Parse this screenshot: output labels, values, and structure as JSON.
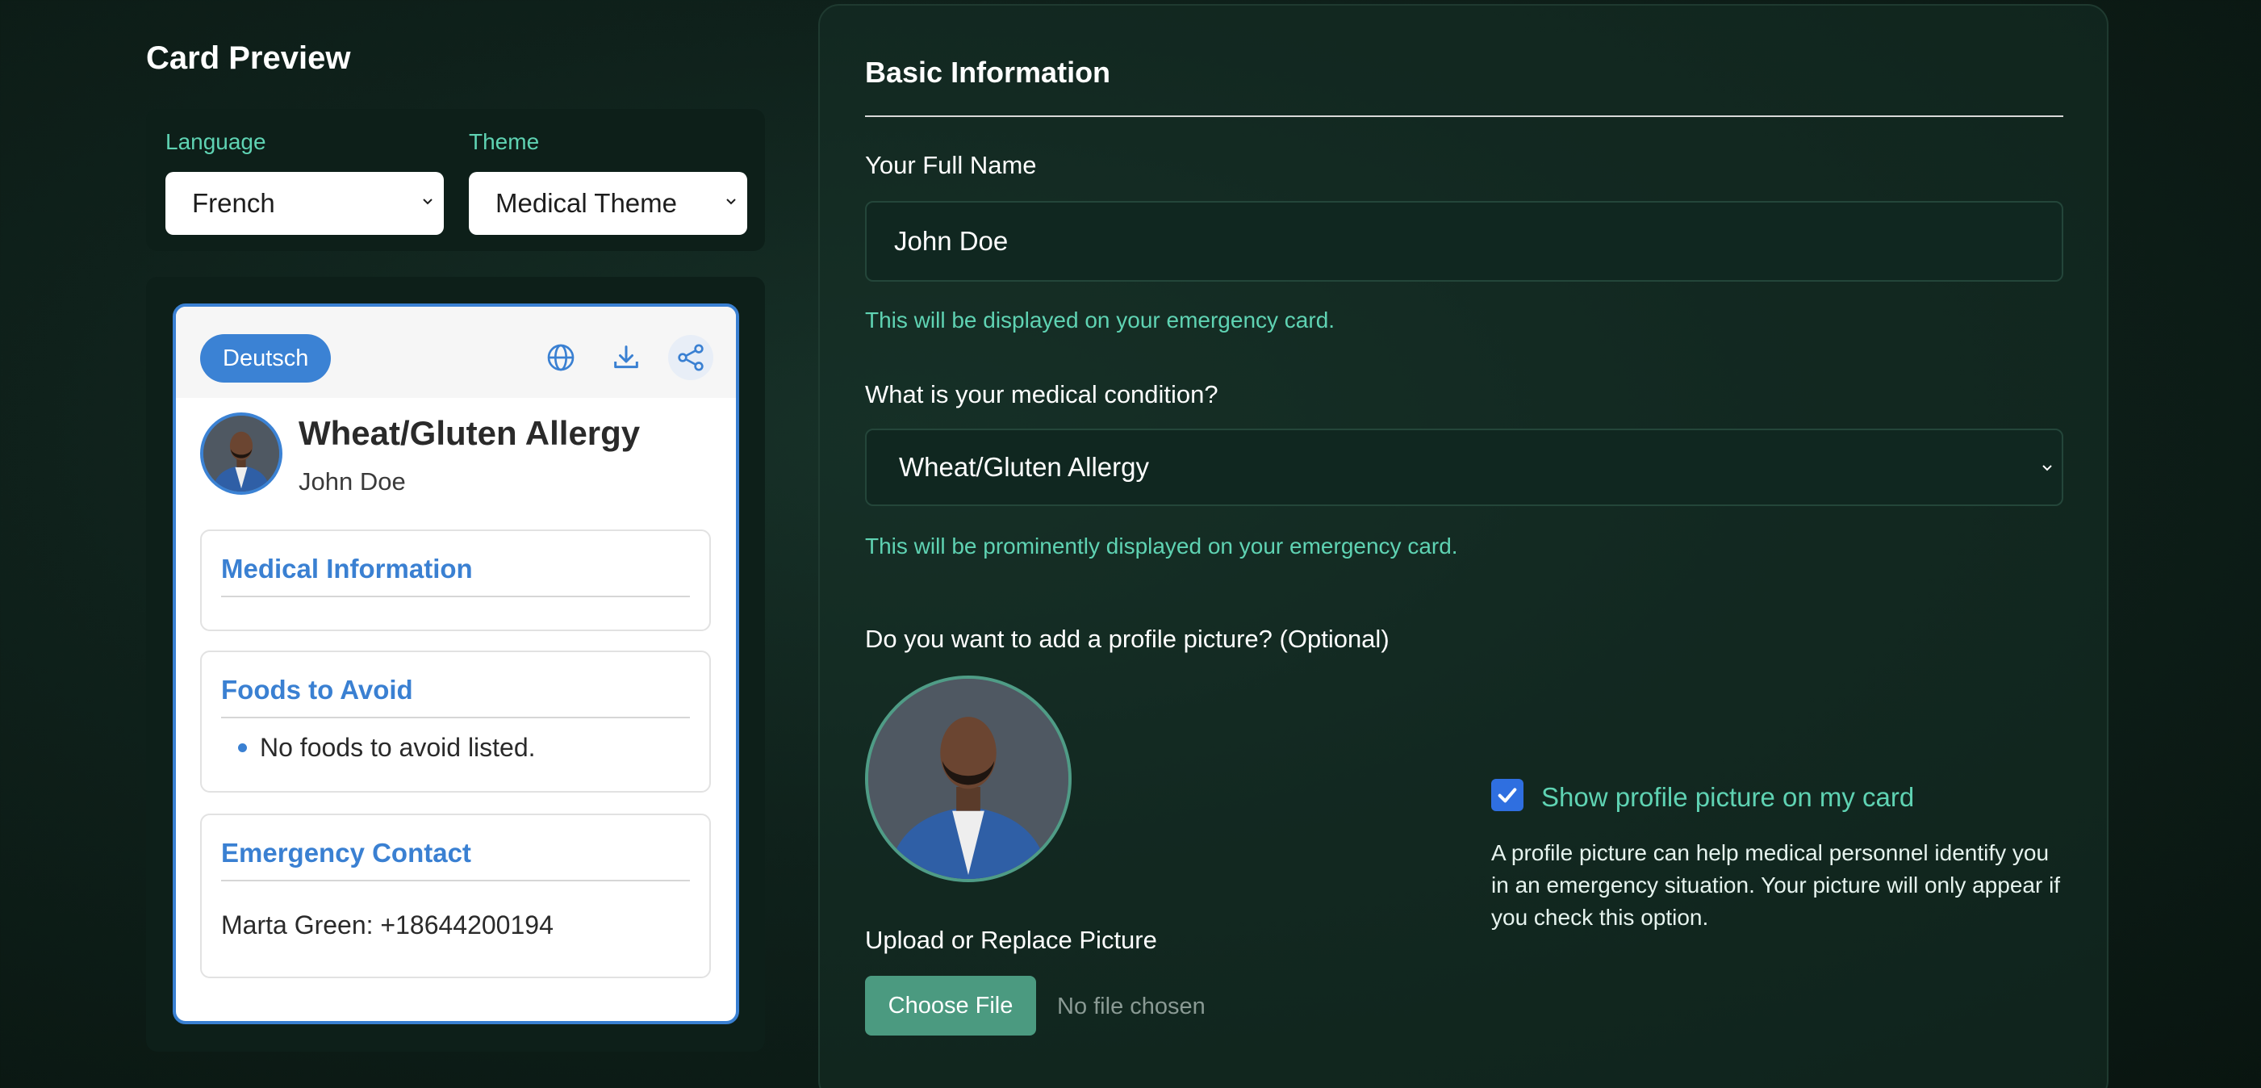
{
  "left": {
    "title": "Card Preview",
    "language": {
      "label": "Language",
      "value": "French"
    },
    "theme": {
      "label": "Theme",
      "value": "Medical Theme"
    }
  },
  "card": {
    "language_badge": "Deutsch",
    "condition": "Wheat/Gluten Allergy",
    "name": "John Doe",
    "medical_info_title": "Medical Information",
    "foods_title": "Foods to Avoid",
    "foods_items": [
      "No foods to avoid listed."
    ],
    "emergency_title": "Emergency Contact",
    "emergency_contact": "Marta Green: +18644200194",
    "icons": [
      "globe-icon",
      "download-icon",
      "share-icon"
    ]
  },
  "form": {
    "section_title": "Basic Information",
    "name_label": "Your Full Name",
    "name_value": "John Doe",
    "name_hint": "This will be displayed on your emergency card.",
    "condition_label": "What is your medical condition?",
    "condition_value": "Wheat/Gluten Allergy",
    "condition_hint": "This will be prominently displayed on your emergency card.",
    "picture_label": "Do you want to add a profile picture? (Optional)",
    "show_picture_label": "Show profile picture on my card",
    "show_picture_checked": true,
    "show_picture_desc": "A profile picture can help medical personnel identify you in an emergency situation. Your picture will only appear if you check this option.",
    "upload_label": "Upload or Replace Picture",
    "choose_file": "Choose File",
    "no_file": "No file chosen"
  },
  "colors": {
    "accent_teal": "#5fd3b3",
    "card_blue": "#3a80d2",
    "button_green": "#4b9a80",
    "checkbox_blue": "#2f6fe0"
  }
}
